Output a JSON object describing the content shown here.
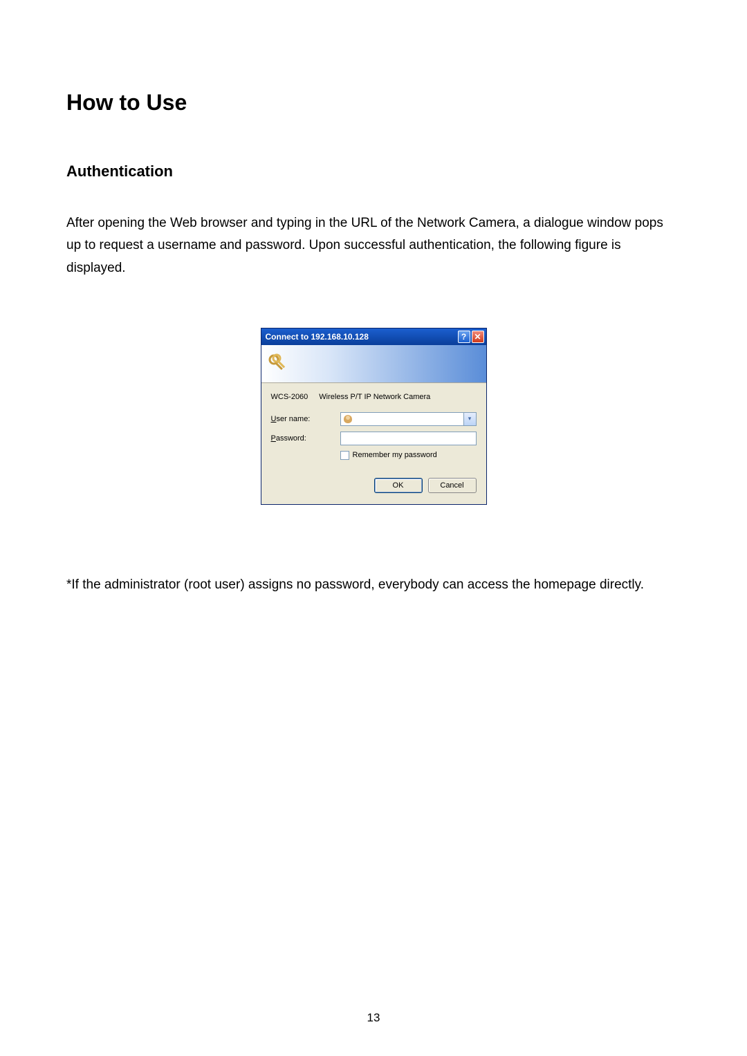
{
  "headings": {
    "h1": "How to Use",
    "h2": "Authentication"
  },
  "paragraphs": {
    "intro": "After opening the Web browser and typing in the URL of the Network Camera, a dialogue window pops up to request a username and password. Upon successful authentication, the following figure is displayed.",
    "note": "*If the administrator (root user) assigns no password, everybody can access the homepage directly."
  },
  "dialog": {
    "title": "Connect to 192.168.10.128",
    "realm_id": "WCS-2060",
    "realm_desc": "Wireless P/T IP Network Camera",
    "labels": {
      "username_prefix": "U",
      "username_rest": "ser name:",
      "password_prefix": "P",
      "password_rest": "assword:",
      "remember_prefix": "R",
      "remember_rest": "emember my password"
    },
    "buttons": {
      "ok": "OK",
      "cancel": "Cancel"
    },
    "values": {
      "username": "",
      "password": ""
    }
  },
  "page_number": "13"
}
